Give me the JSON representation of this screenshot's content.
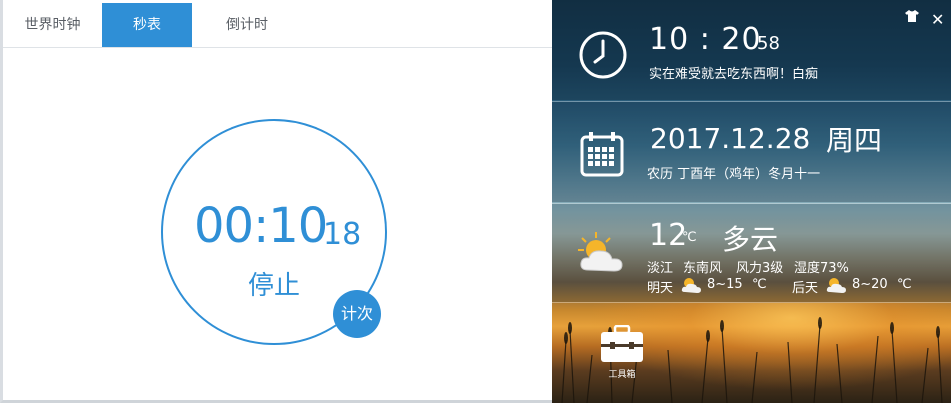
{
  "tabs": [
    {
      "label": "世界时钟"
    },
    {
      "label": "秒表",
      "active": true
    },
    {
      "label": "倒计时"
    }
  ],
  "stopwatch": {
    "time": "00:10",
    "fraction": "18",
    "stop_label": "停止",
    "lap_label": "计次"
  },
  "clock": {
    "time": "10 : 20",
    "seconds": "58",
    "message": "实在难受就去吃东西啊！白痴"
  },
  "date": {
    "date": "2017.12.28",
    "weekday": "周四",
    "lunar": "农历 丁酉年（鸡年）冬月十一"
  },
  "weather": {
    "temp": "12",
    "unit": "℃",
    "condition": "多云",
    "location": "淡江",
    "wind": "东南风",
    "wind_level": "风力3级",
    "humidity": "湿度73%",
    "tomorrow": {
      "label": "明天",
      "range": "8~15",
      "unit": "℃"
    },
    "after": {
      "label": "后天",
      "range": "8~20",
      "unit": "℃"
    }
  },
  "toolbox": {
    "label": "工具箱"
  },
  "colors": {
    "accent": "#2f8fd6"
  },
  "icons": [
    "clock-icon",
    "calendar-icon",
    "partly-cloudy-icon",
    "toolbox-icon",
    "close-icon",
    "skin-shirt-icon"
  ]
}
